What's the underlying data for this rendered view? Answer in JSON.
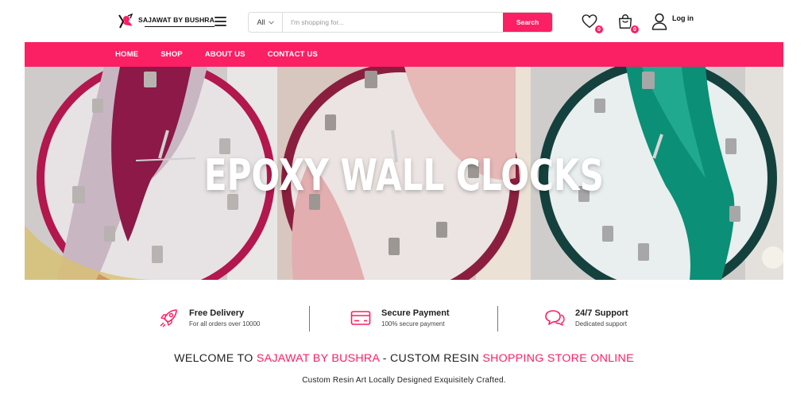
{
  "brand": {
    "name": "SAJAWAT BY BUSHRA",
    "accent": "#fb1f64"
  },
  "search": {
    "category": "All",
    "placeholder": "I'm shopping for...",
    "button_label": "Search"
  },
  "header": {
    "wishlist_count": "0",
    "cart_count": "0",
    "login_label": "Log in"
  },
  "nav": {
    "items": [
      {
        "label": "HOME"
      },
      {
        "label": "SHOP"
      },
      {
        "label": "ABOUT US"
      },
      {
        "label": "CONTACT US"
      }
    ]
  },
  "banner": {
    "title": "EPOXY WALL CLOCKS"
  },
  "features": [
    {
      "icon": "rocket-icon",
      "title": "Free Delivery",
      "subtitle": "For all orders over 10000"
    },
    {
      "icon": "credit-card-icon",
      "title": "Secure Payment",
      "subtitle": "100% secure payment"
    },
    {
      "icon": "chat-icon",
      "title": "24/7 Support",
      "subtitle": "Dedicated support"
    }
  ],
  "welcome": {
    "part1": "WELCOME TO ",
    "part2": "SAJAWAT BY BUSHRA",
    "part3": " - CUSTOM RESIN ",
    "part4": "SHOPPING STORE ONLINE",
    "tagline": "Custom Resin Art Locally Designed Exquisitely Crafted."
  }
}
